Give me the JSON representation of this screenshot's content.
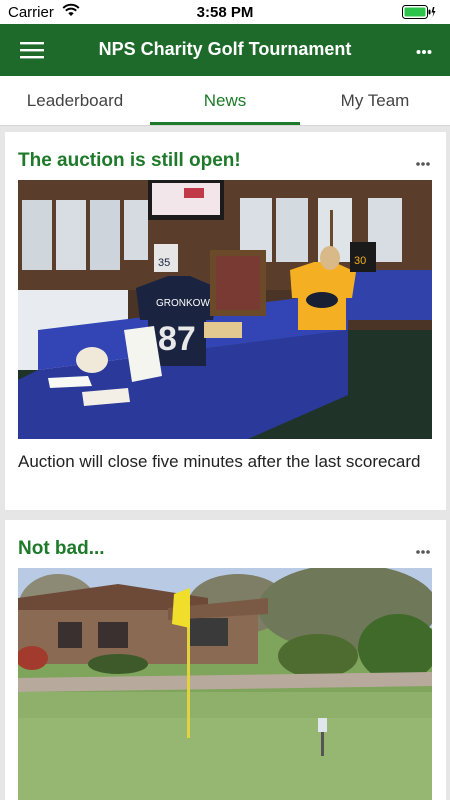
{
  "status_bar": {
    "carrier": "Carrier",
    "time": "3:58 PM"
  },
  "app_bar": {
    "title": "NPS Charity Golf Tournament"
  },
  "tabs": [
    {
      "label": "Leaderboard",
      "active": false
    },
    {
      "label": "News",
      "active": true
    },
    {
      "label": "My Team",
      "active": false
    }
  ],
  "posts": [
    {
      "title": "The auction is still open!",
      "body": "Auction will close five minutes after the last scorecard",
      "photo": "auction-room-photo"
    },
    {
      "title": "Not bad...",
      "body": "",
      "photo": "golf-green-photo"
    }
  ],
  "photo_text": {
    "jersey_name": "GRONKOWSKI",
    "jersey_number": "87",
    "small_jersey_1": "35",
    "small_jersey_2": "30"
  },
  "colors": {
    "primary": "#1e6a2a",
    "accent": "#1e7a2a"
  },
  "icons": [
    "menu-icon",
    "wifi-icon",
    "battery-icon",
    "more-icon"
  ]
}
